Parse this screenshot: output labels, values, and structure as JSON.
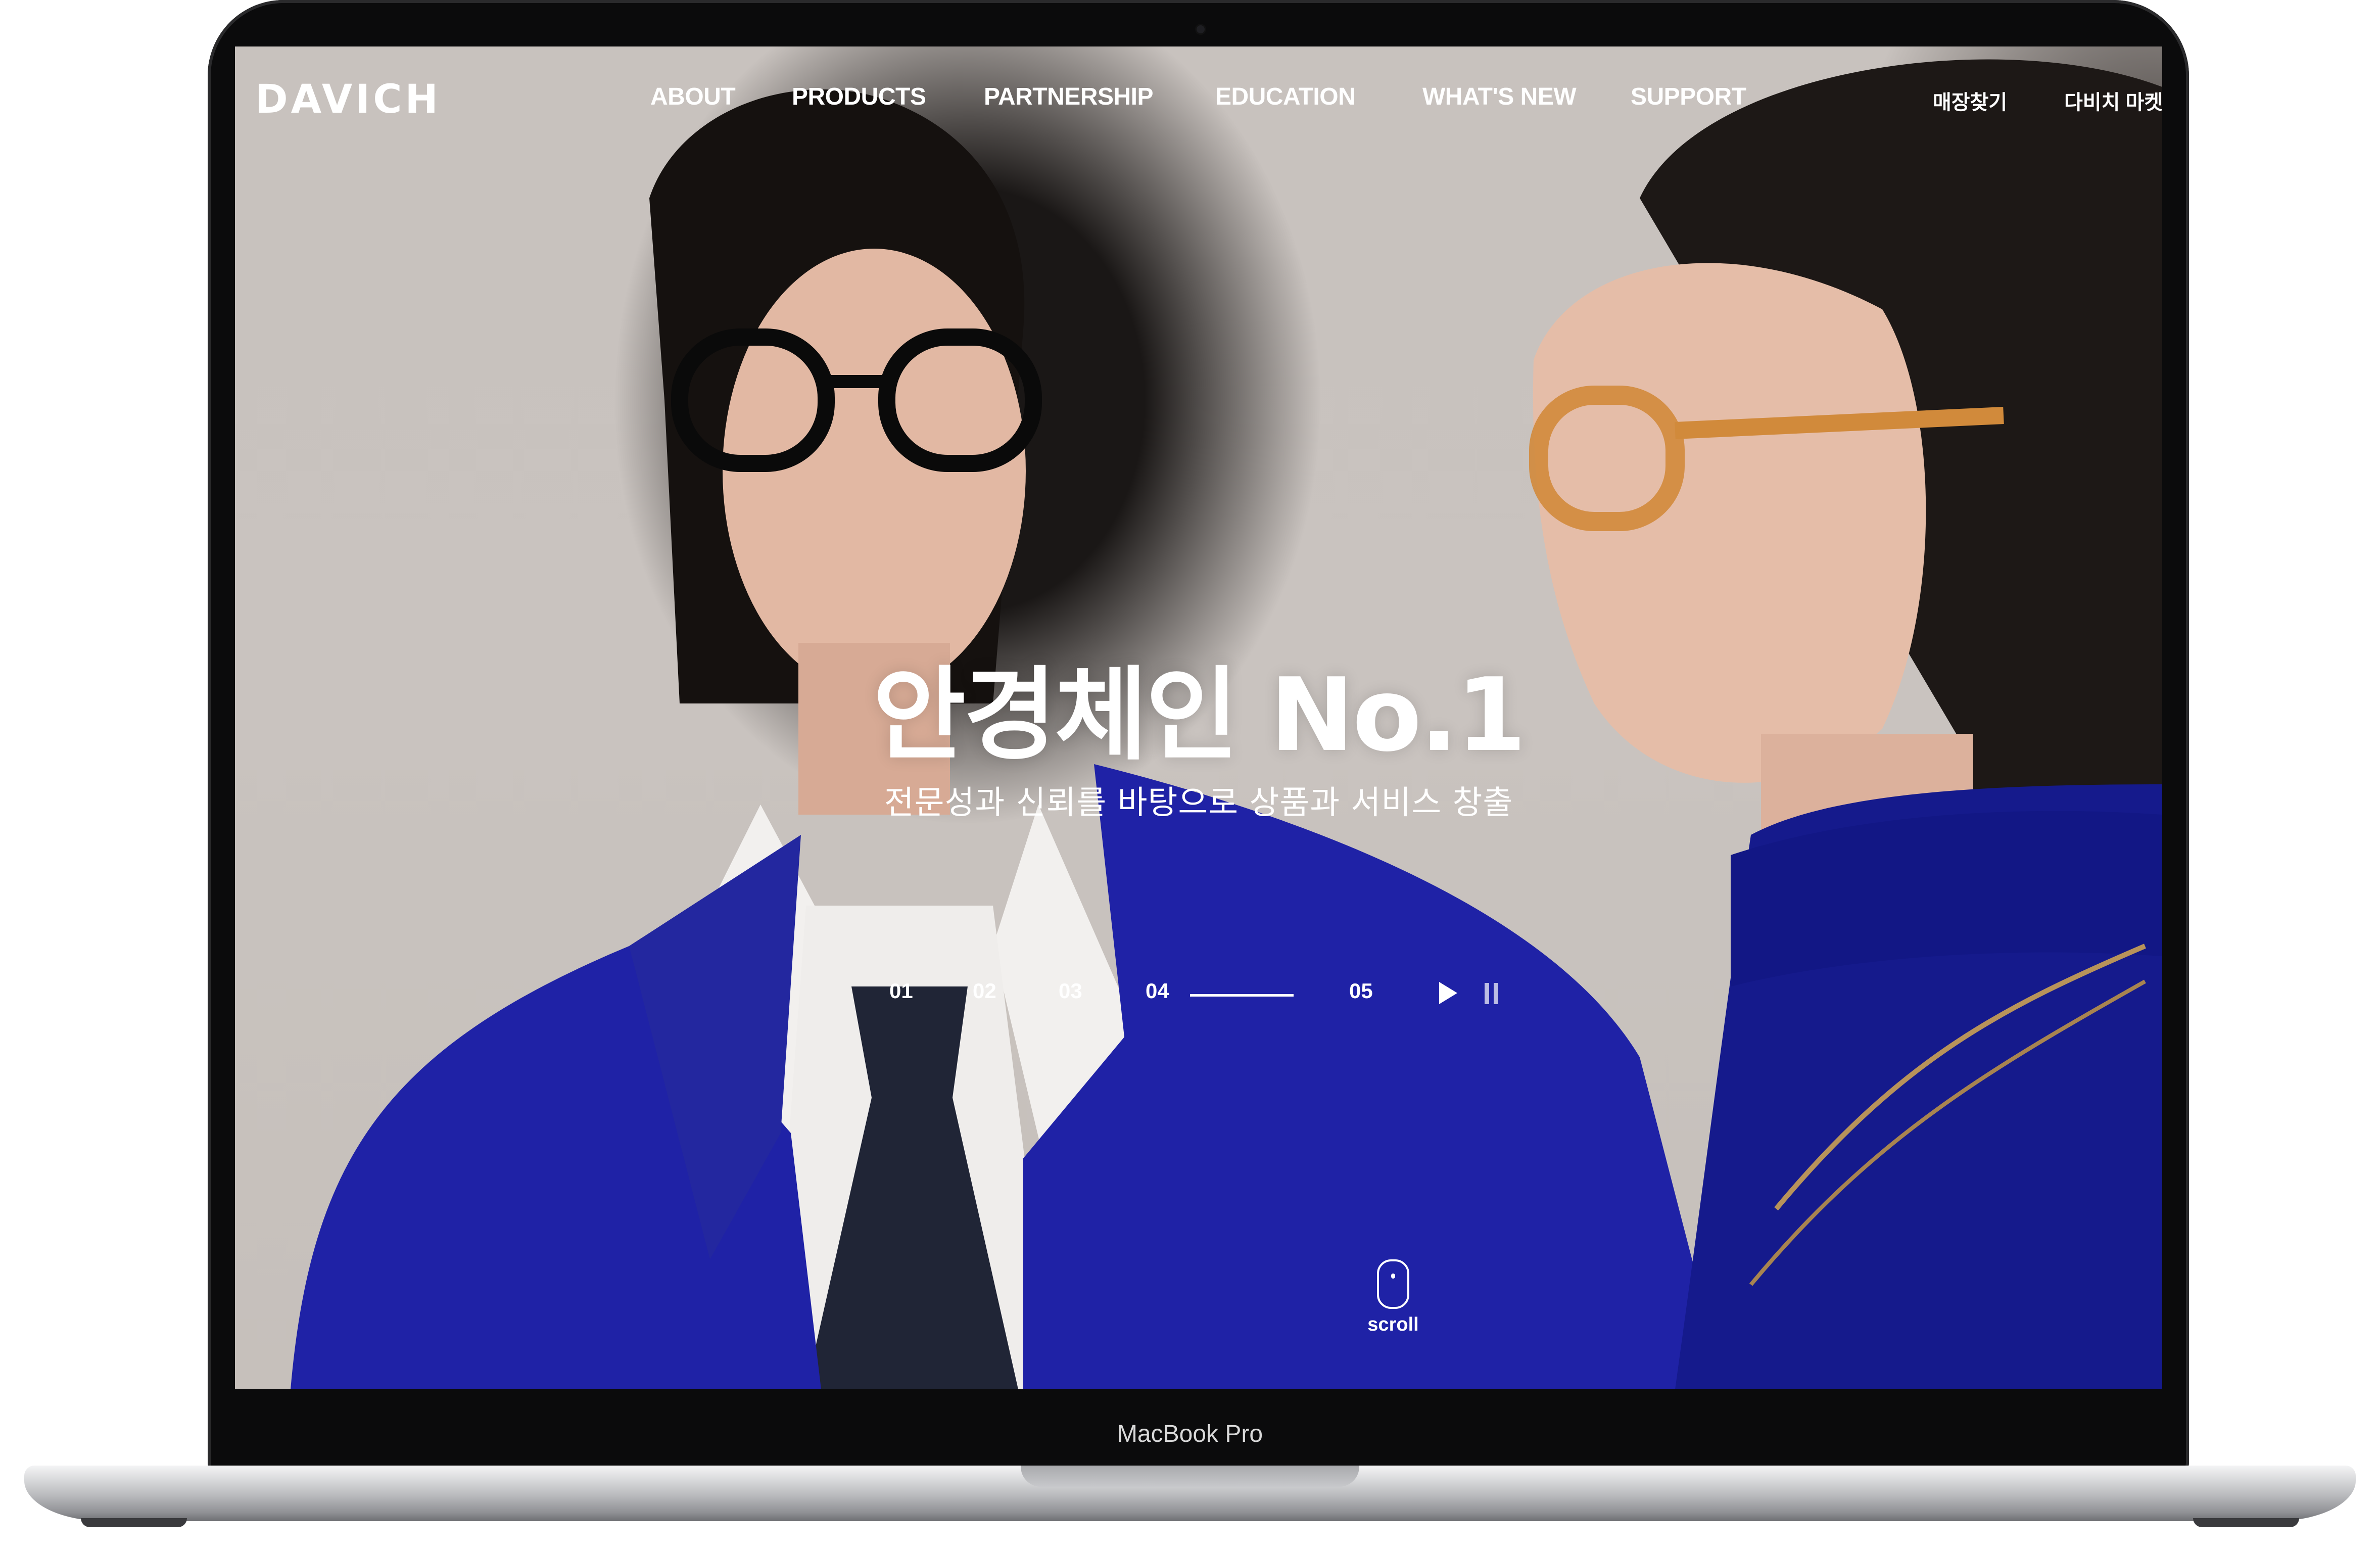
{
  "device": {
    "label": "MacBook Pro"
  },
  "nav": {
    "logo": "DAVICH",
    "items": [
      "ABOUT",
      "PRODUCTS",
      "PARTNERSHIP",
      "EDUCATION",
      "WHAT'S NEW",
      "SUPPORT"
    ],
    "utility": [
      "매장찾기",
      "다비치 마켓"
    ]
  },
  "hero": {
    "title": "안경체인 No.1",
    "subtitle": "전문성과 신뢰를 바탕으로 상품과 서비스 창출"
  },
  "slider": {
    "pages": [
      "01",
      "02",
      "03",
      "04",
      "05"
    ],
    "active_page": "04",
    "play_icon": "play-icon",
    "pause_icon": "pause-icon"
  },
  "scroll": {
    "label": "scroll",
    "icon": "mouse-icon"
  },
  "colors": {
    "suit_blue": "#1f22a6",
    "text": "#ffffff",
    "bezel": "#0b0b0c"
  }
}
